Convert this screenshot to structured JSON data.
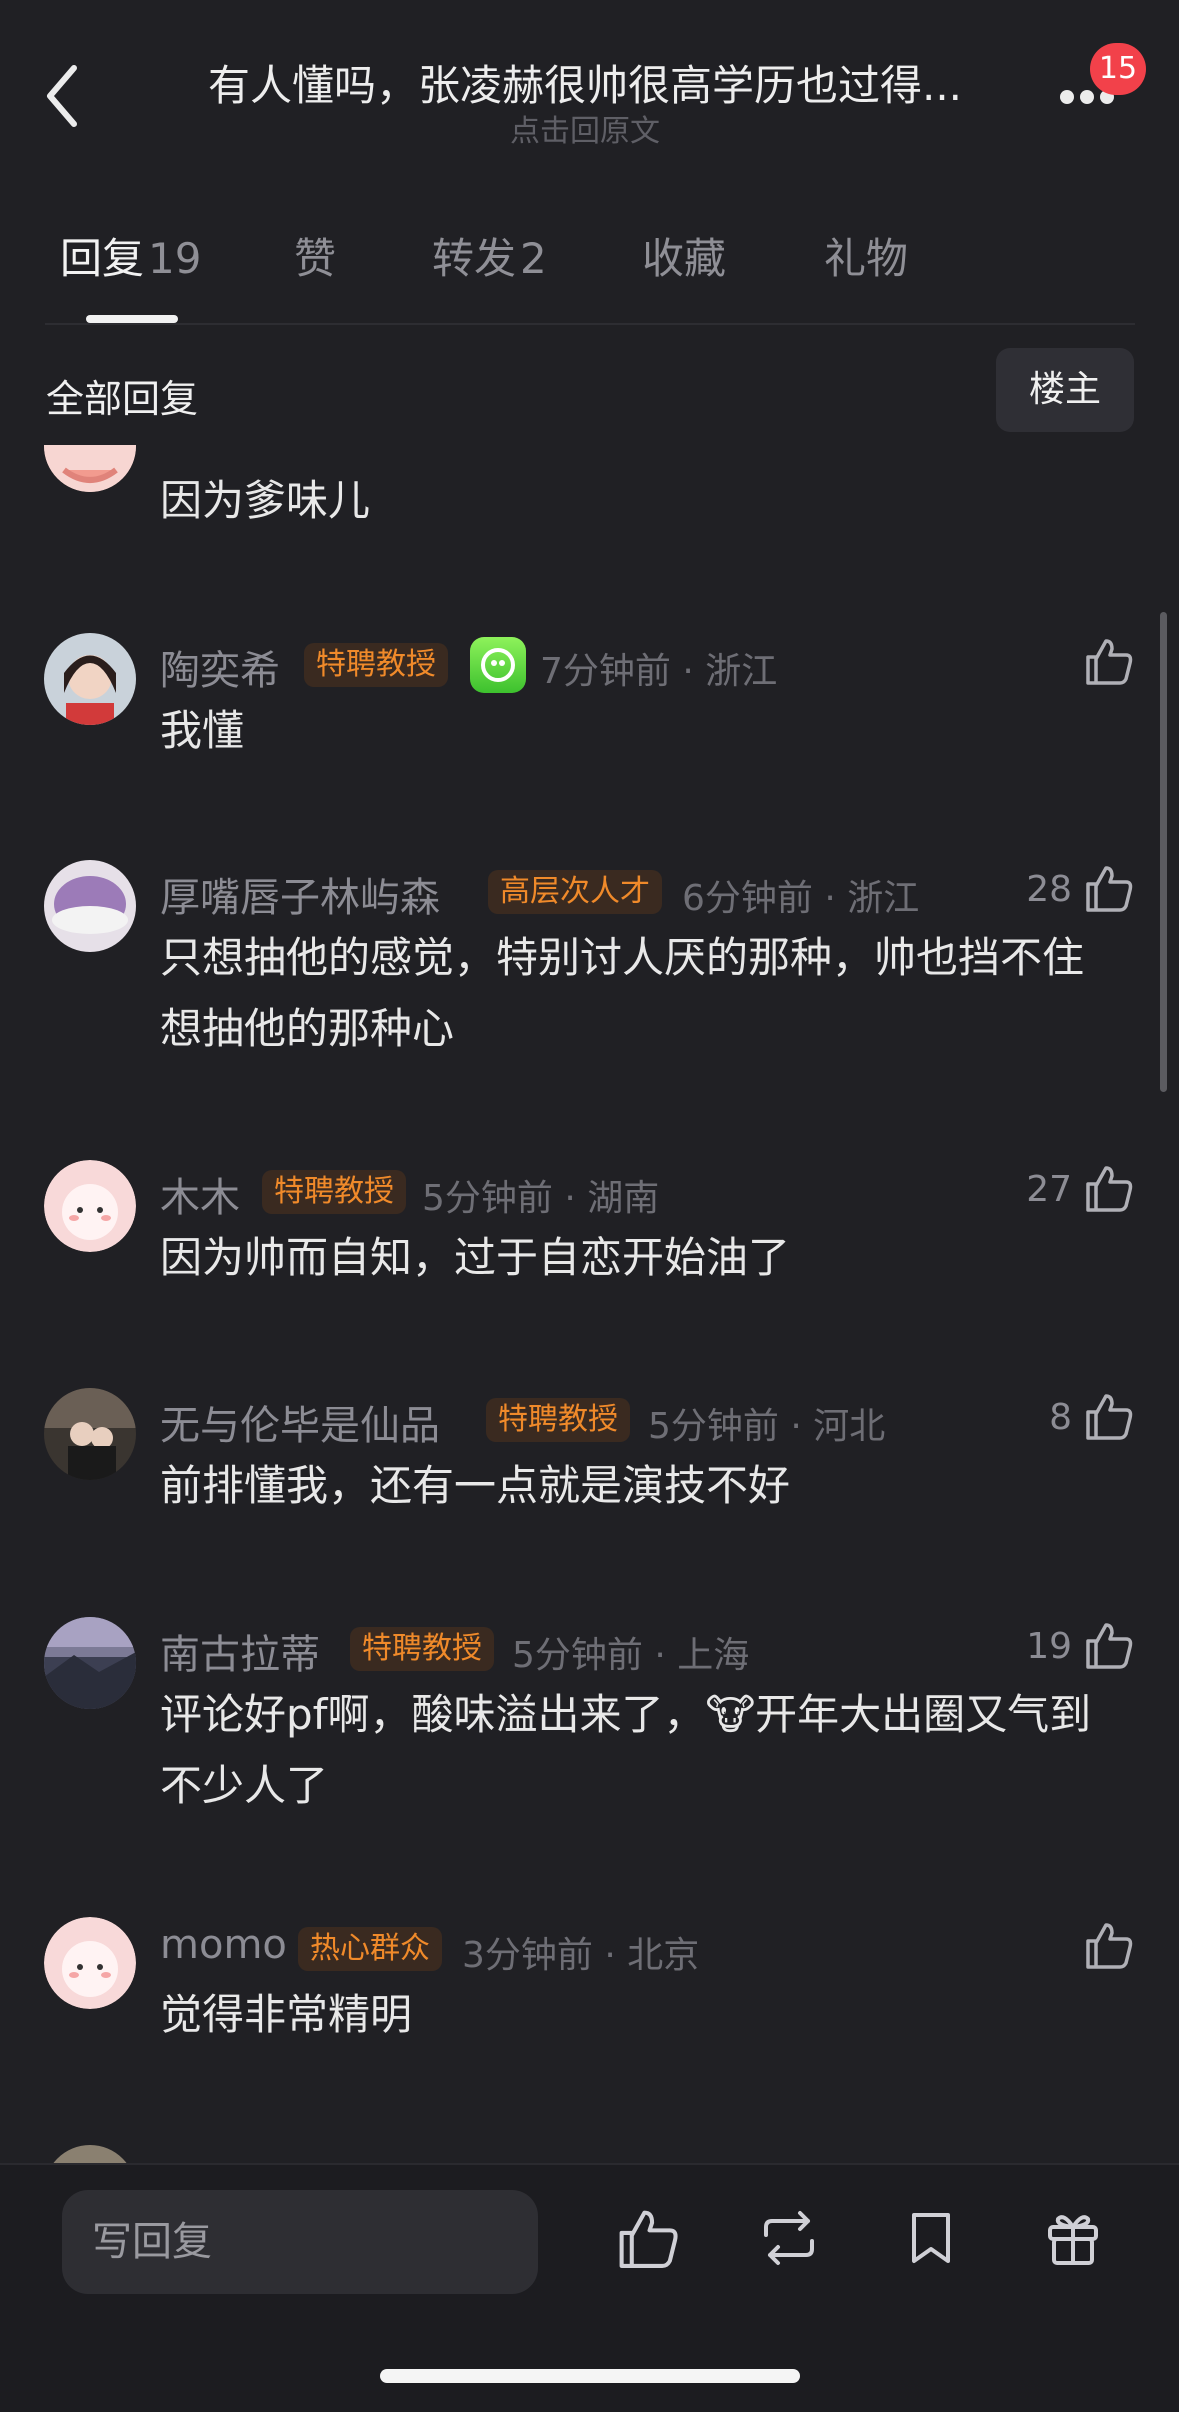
{
  "header": {
    "title": "有人懂吗，张凌赫很帅很高学历也过得...",
    "subtitle": "点击回原文",
    "badge_count": "15"
  },
  "tabs": [
    {
      "label": "回复",
      "count": "19"
    },
    {
      "label": "赞",
      "count": ""
    },
    {
      "label": "转发",
      "count": "2"
    },
    {
      "label": "收藏",
      "count": ""
    },
    {
      "label": "礼物",
      "count": ""
    }
  ],
  "section": {
    "all_replies": "全部回复",
    "op_filter": "楼主"
  },
  "comments": [
    {
      "user": "",
      "tag": "",
      "time": "",
      "location": "",
      "likes": "",
      "text": "因为爹味儿"
    },
    {
      "user": "陶奕希",
      "tag": "特聘教授",
      "time": "7分钟前",
      "location": "浙江",
      "likes": "",
      "text": "我懂"
    },
    {
      "user": "厚嘴唇子林屿森",
      "tag": "高层次人才",
      "time": "6分钟前",
      "location": "浙江",
      "likes": "28",
      "text": "只想抽他的感觉，特别讨人厌的那种，帅也挡不住想抽他的那种心"
    },
    {
      "user": "木木",
      "tag": "特聘教授",
      "time": "5分钟前",
      "location": "湖南",
      "likes": "27",
      "text": "因为帅而自知，过于自恋开始油了"
    },
    {
      "user": "无与伦毕是仙品",
      "tag": "特聘教授",
      "time": "5分钟前",
      "location": "河北",
      "likes": "8",
      "text": "前排懂我，还有一点就是演技不好"
    },
    {
      "user": "南古拉蒂",
      "tag": "特聘教授",
      "time": "5分钟前",
      "location": "上海",
      "likes": "19",
      "text": "评论好pf啊，酸味溢出来了，🐮开年大出圈又气到不少人了"
    },
    {
      "user": "momo",
      "tag": "热心群众",
      "time": "3分钟前",
      "location": "北京",
      "likes": "",
      "text": "觉得非常精明"
    }
  ],
  "bottom_bar": {
    "reply_placeholder": "写回复"
  },
  "colors": {
    "background": "#202024",
    "tag_text": "#f08a2a",
    "tag_bg": "#3a2a20",
    "badge": "#f2414a"
  }
}
